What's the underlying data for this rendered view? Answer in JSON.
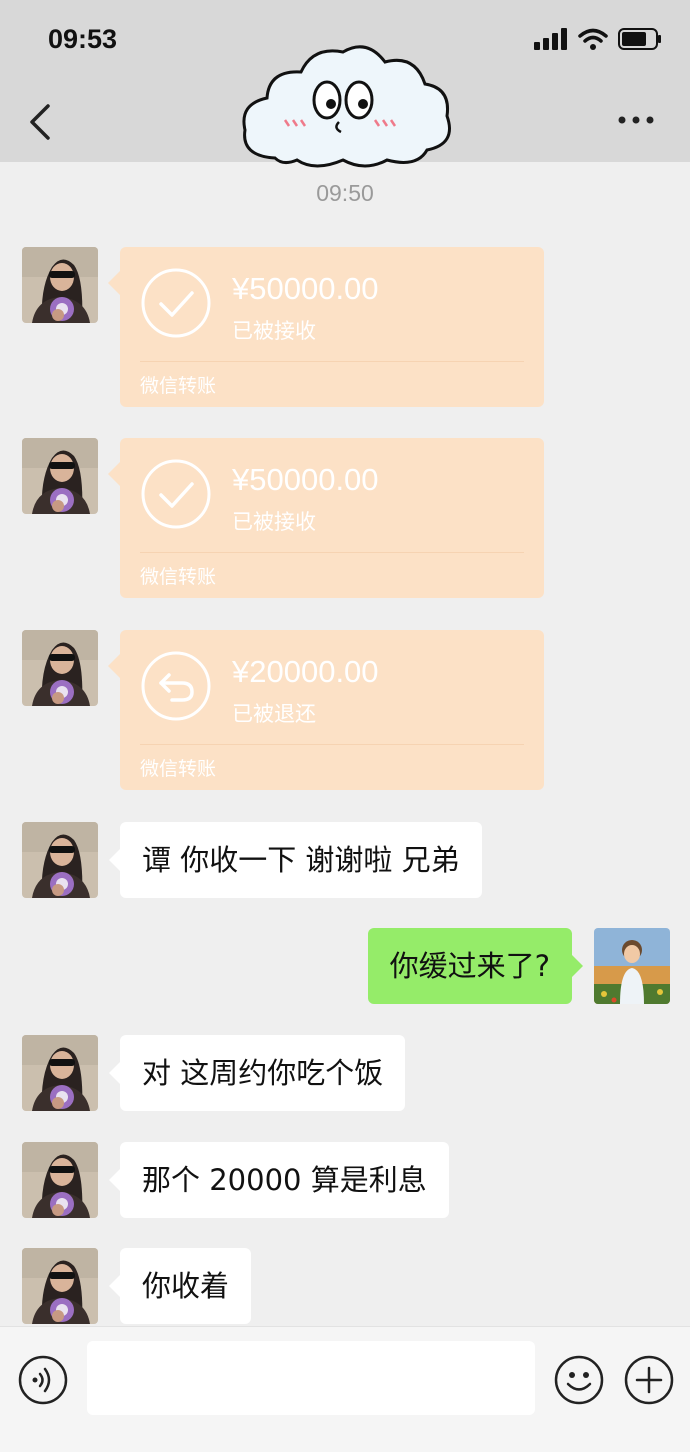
{
  "status_bar": {
    "time": "09:53"
  },
  "header": {
    "back_icon": "chevron-left-icon",
    "more_icon": "ellipsis-icon",
    "contact_avatar": "cloud-cartoon"
  },
  "timestamp": "09:50",
  "transfers": [
    {
      "amount": "¥50000.00",
      "status": "已被接收",
      "label": "微信转账",
      "icon": "check-circle-icon"
    },
    {
      "amount": "¥50000.00",
      "status": "已被接收",
      "label": "微信转账",
      "icon": "check-circle-icon"
    },
    {
      "amount": "¥20000.00",
      "status": "已被退还",
      "label": "微信转账",
      "icon": "return-circle-icon"
    }
  ],
  "messages": [
    {
      "side": "left",
      "text": "谭 你收一下 谢谢啦 兄弟"
    },
    {
      "side": "right",
      "text": "你缓过来了?"
    },
    {
      "side": "left",
      "text": "对 这周约你吃个饭"
    },
    {
      "side": "left",
      "text": "那个 20000 算是利息"
    },
    {
      "side": "left",
      "text": "你收着"
    }
  ],
  "input_bar": {
    "value": "",
    "voice_icon": "voice-icon",
    "emoji_icon": "emoji-icon",
    "plus_icon": "plus-icon"
  },
  "colors": {
    "transfer_bg": "#fce1c6",
    "my_bubble": "#95ec69",
    "their_bubble": "#ffffff",
    "chat_bg": "#efefef",
    "header_bg": "#d8d8d8"
  }
}
